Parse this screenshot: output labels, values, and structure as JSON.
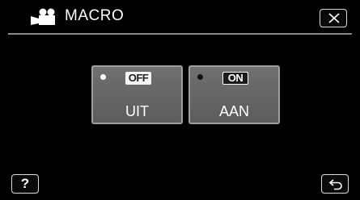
{
  "header": {
    "title": "MACRO",
    "icon": "video-camera-icon",
    "close_icon": "close-icon"
  },
  "options": [
    {
      "badge": "OFF",
      "label": "UIT",
      "selected": true
    },
    {
      "badge": "ON",
      "label": "AAN",
      "selected": false
    }
  ],
  "footer": {
    "help_label": "?",
    "back_icon": "return-icon"
  },
  "colors": {
    "background": "#000000",
    "button_fill": "#666666",
    "button_border": "#9e9e9e",
    "text": "#ffffff"
  }
}
